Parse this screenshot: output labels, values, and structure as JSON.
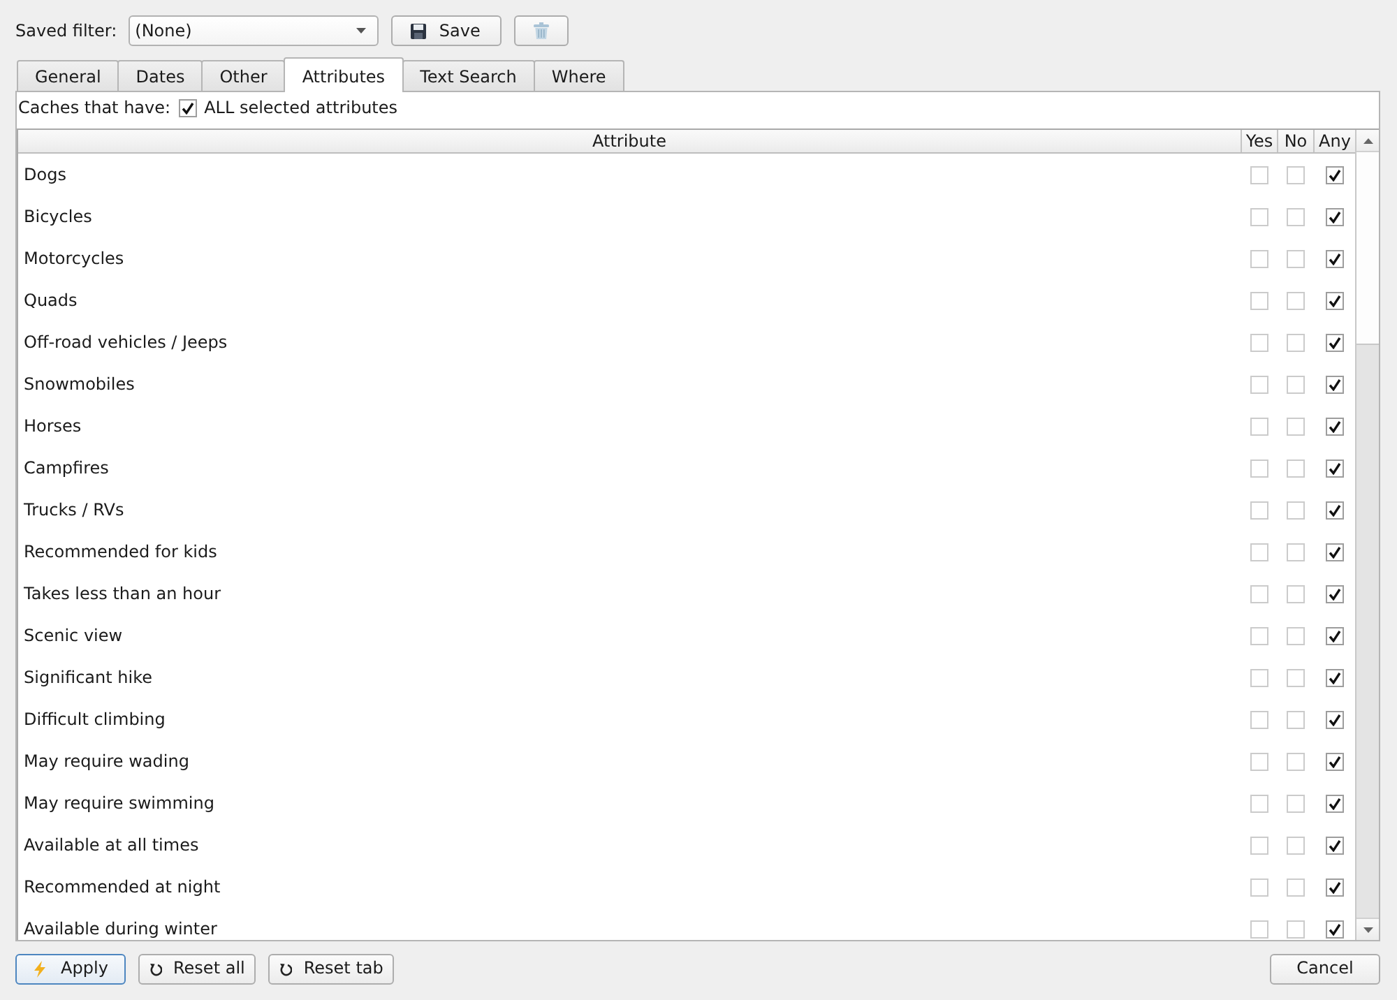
{
  "saved_filter": {
    "label": "Saved filter:",
    "value": "(None)"
  },
  "toolbar_buttons": [
    {
      "kind": "save",
      "label": "Save"
    },
    {
      "kind": "delete"
    }
  ],
  "tabs": [
    {
      "label": "General",
      "selected": false
    },
    {
      "label": "Dates",
      "selected": false
    },
    {
      "label": "Other",
      "selected": false
    },
    {
      "label": "Attributes",
      "selected": true
    },
    {
      "label": "Text Search",
      "selected": false
    },
    {
      "label": "Where",
      "selected": false
    }
  ],
  "attributes_panel": {
    "match_label": "Caches that have:",
    "match_option": {
      "label": "ALL selected attributes",
      "checked": true
    },
    "table": {
      "columns": [
        {
          "label": "Attribute"
        },
        {
          "label": "Yes"
        },
        {
          "label": "No"
        },
        {
          "label": "Any"
        }
      ],
      "rows": [
        {
          "attribute": "Dogs",
          "yes": false,
          "no": false,
          "any": true
        },
        {
          "attribute": "Bicycles",
          "yes": false,
          "no": false,
          "any": true
        },
        {
          "attribute": "Motorcycles",
          "yes": false,
          "no": false,
          "any": true
        },
        {
          "attribute": "Quads",
          "yes": false,
          "no": false,
          "any": true
        },
        {
          "attribute": "Off-road vehicles / Jeeps",
          "yes": false,
          "no": false,
          "any": true
        },
        {
          "attribute": "Snowmobiles",
          "yes": false,
          "no": false,
          "any": true
        },
        {
          "attribute": "Horses",
          "yes": false,
          "no": false,
          "any": true
        },
        {
          "attribute": "Campfires",
          "yes": false,
          "no": false,
          "any": true
        },
        {
          "attribute": "Trucks / RVs",
          "yes": false,
          "no": false,
          "any": true
        },
        {
          "attribute": "Recommended for kids",
          "yes": false,
          "no": false,
          "any": true
        },
        {
          "attribute": "Takes less than an hour",
          "yes": false,
          "no": false,
          "any": true
        },
        {
          "attribute": "Scenic view",
          "yes": false,
          "no": false,
          "any": true
        },
        {
          "attribute": "Significant hike",
          "yes": false,
          "no": false,
          "any": true
        },
        {
          "attribute": "Difficult climbing",
          "yes": false,
          "no": false,
          "any": true
        },
        {
          "attribute": "May require wading",
          "yes": false,
          "no": false,
          "any": true
        },
        {
          "attribute": "May require swimming",
          "yes": false,
          "no": false,
          "any": true
        },
        {
          "attribute": "Available at all times",
          "yes": false,
          "no": false,
          "any": true
        },
        {
          "attribute": "Recommended at night",
          "yes": false,
          "no": false,
          "any": true
        },
        {
          "attribute": "Available during winter",
          "yes": false,
          "no": false,
          "any": true
        }
      ]
    }
  },
  "footer_buttons": [
    {
      "kind": "apply",
      "label": "Apply",
      "default": true
    },
    {
      "kind": "reset",
      "label": "Reset all",
      "default": false
    },
    {
      "kind": "reset",
      "label": "Reset tab",
      "default": false
    },
    {
      "kind": "cancel",
      "label": "Cancel",
      "default": false
    }
  ]
}
